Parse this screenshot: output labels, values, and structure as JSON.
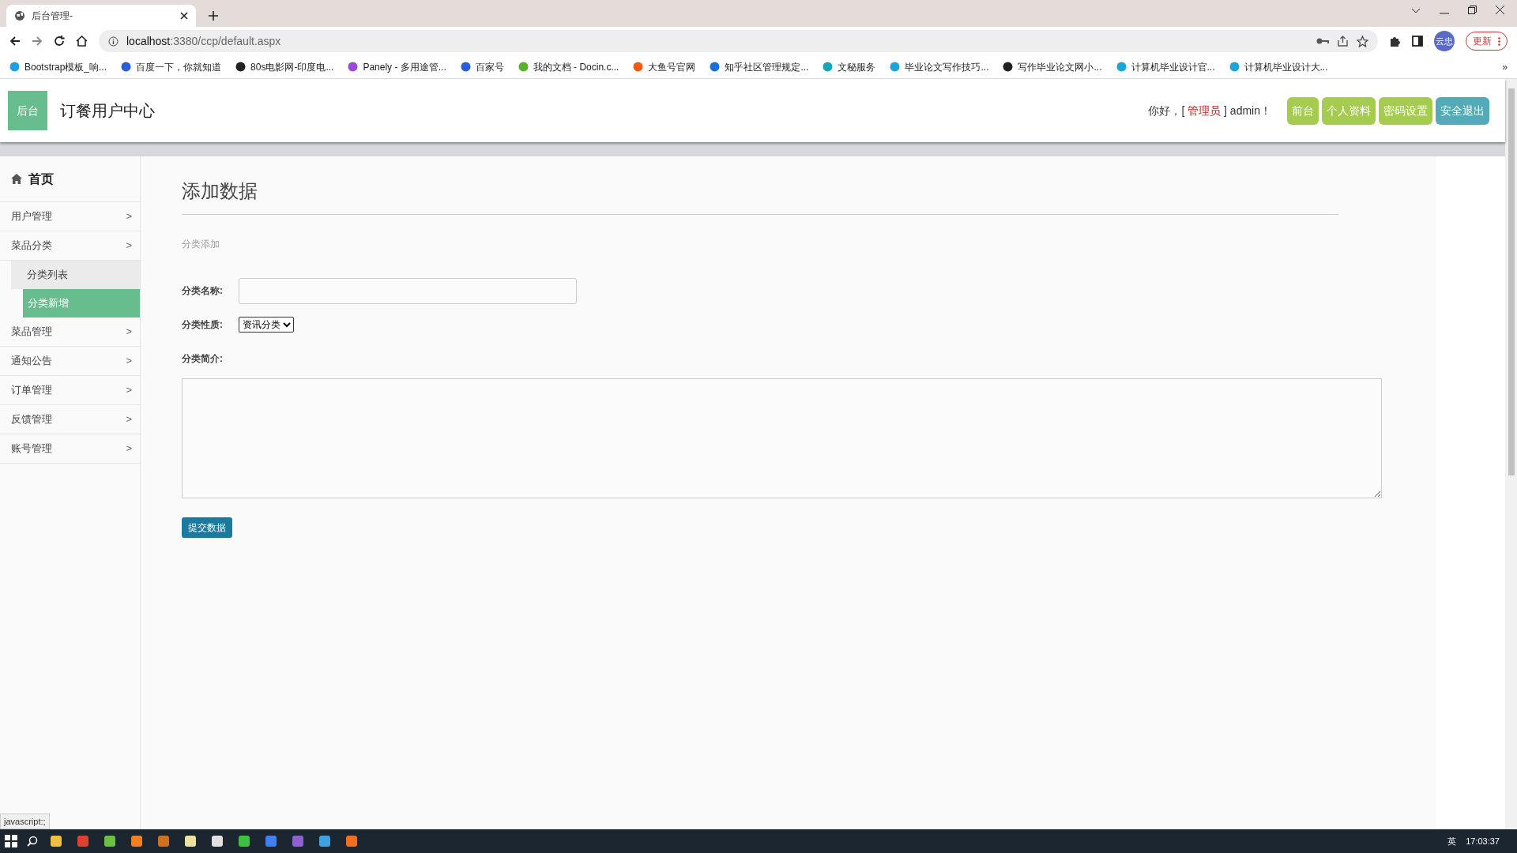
{
  "browser": {
    "tab_title": "后台管理-",
    "url_host": "localhost",
    "url_rest": ":3380/ccp/default.aspx",
    "profile": "云忠",
    "update_button": "更新",
    "bookmarks": [
      "Bootstrap模板_响...",
      "百度一下，你就知道",
      "80s电影网-印度电...",
      "Panely - 多用途管...",
      "百家号",
      "我的文档 - Docin.c...",
      "大鱼号官网",
      "知乎社区管理规定...",
      "文秘服务",
      "毕业论文写作技巧...",
      "写作毕业论文网小...",
      "计算机毕业设计官...",
      "计算机毕业设计大..."
    ],
    "more_bookmarks": "»"
  },
  "header": {
    "logo": "后台",
    "title": "订餐用户中心",
    "greeting_prefix": "你好，[",
    "greeting_role": "管理员",
    "greeting_suffix": "] admin！",
    "buttons": [
      {
        "label": "前台",
        "color": "#a5cc4e"
      },
      {
        "label": "个人资料",
        "color": "#a5cc4e"
      },
      {
        "label": "密码设置",
        "color": "#a5cc4e"
      },
      {
        "label": "安全退出",
        "color": "#52abb6"
      }
    ]
  },
  "sidebar": {
    "home": "首页",
    "items": [
      {
        "label": "用户管理",
        "chevron": ">"
      },
      {
        "label": "菜品分类",
        "chevron": ">",
        "expanded": true,
        "children": [
          {
            "label": "分类列表",
            "selected": false
          },
          {
            "label": "分类新增",
            "selected": true
          }
        ]
      },
      {
        "label": "菜品管理",
        "chevron": ">"
      },
      {
        "label": "通知公告",
        "chevron": ">"
      },
      {
        "label": "订单管理",
        "chevron": ">"
      },
      {
        "label": "反馈管理",
        "chevron": ">"
      },
      {
        "label": "账号管理",
        "chevron": ">"
      }
    ]
  },
  "form": {
    "title": "添加数据",
    "subtitle": "分类添加",
    "fields": [
      {
        "kind": "text",
        "label": "分类名称:"
      },
      {
        "kind": "select",
        "label": "分类性质:",
        "value": "资讯分类"
      },
      {
        "kind": "textarea",
        "label": "分类简介:"
      }
    ],
    "submit": "提交数据"
  },
  "status_bar": "javascript:;",
  "taskbar": {
    "ime": "英",
    "time": "17:03:37"
  }
}
